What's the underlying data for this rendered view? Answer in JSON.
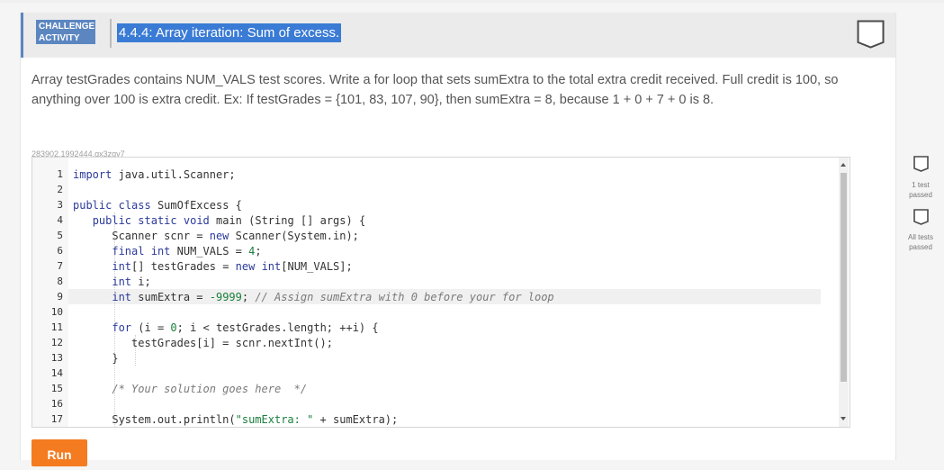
{
  "header": {
    "badge_line1": "CHALLENGE",
    "badge_line2": "ACTIVITY",
    "title": "4.4.4: Array iteration: Sum of excess."
  },
  "description": "Array testGrades contains NUM_VALS test scores. Write a for loop that sets sumExtra to the total extra credit received. Full credit is 100, so anything over 100 is extra credit. Ex: If testGrades = {101, 83, 107, 90}, then sumExtra = 8, because 1 + 0 + 7 + 0 is 8.",
  "problem_id": "283902.1992444.qx3zqy7",
  "editor": {
    "line_numbers": [
      "1",
      "2",
      "3",
      "4",
      "5",
      "6",
      "7",
      "8",
      "9",
      "10",
      "11",
      "12",
      "13",
      "14",
      "15",
      "16",
      "17"
    ],
    "lines": [
      "import java.util.Scanner;",
      "",
      "public class SumOfExcess {",
      "   public static void main (String [] args) {",
      "      Scanner scnr = new Scanner(System.in);",
      "      final int NUM_VALS = 4;",
      "      int[] testGrades = new int[NUM_VALS];",
      "      int i;",
      "      int sumExtra = -9999; // Assign sumExtra with 0 before your for loop",
      "",
      "      for (i = 0; i < testGrades.length; ++i) {",
      "         testGrades[i] = scnr.nextInt();",
      "      }",
      "",
      "      /* Your solution goes here  */",
      "",
      "      System.out.println(\"sumExtra: \" + sumExtra);"
    ],
    "active_line": 9
  },
  "tests": [
    {
      "label_line1": "1 test",
      "label_line2": "passed"
    },
    {
      "label_line1": "All tests",
      "label_line2": "passed"
    }
  ],
  "run_label": "Run",
  "colors": {
    "accent": "#5b86c0",
    "title_highlight": "#3a7bd5",
    "run_button": "#f47b20",
    "keyword": "#2b3a9b",
    "comment": "#7a7a7a",
    "number_string": "#1a7f3c"
  },
  "icons": [
    "completion-shield-icon",
    "test-shield-icon",
    "scroll-up-icon",
    "scroll-down-icon"
  ]
}
